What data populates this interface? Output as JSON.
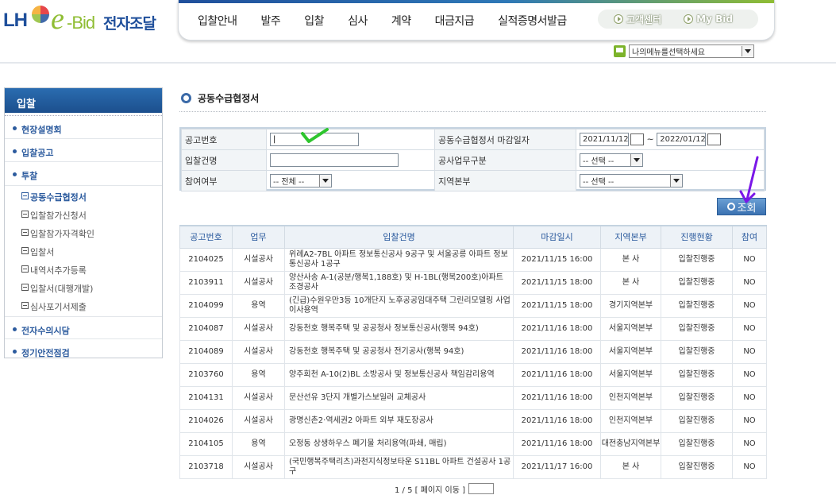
{
  "logo": {
    "lh": "LH",
    "e": "e",
    "bid": "-Bid",
    "kor": "전자조달"
  },
  "gnb": {
    "menu": [
      "입찰안내",
      "발주",
      "입찰",
      "심사",
      "계약",
      "대금지급",
      "실적증명서발급"
    ],
    "quick": [
      "고객센터",
      "My Bid"
    ]
  },
  "menu_select": {
    "value": "나의메뉴를선택하세요"
  },
  "lnb": {
    "title": "입찰",
    "main_items": [
      "현장설명회",
      "입찰공고",
      "투찰"
    ],
    "sub_items": [
      "공동수급협정서",
      "입찰참가신청서",
      "입찰참가자격확인",
      "입찰서",
      "내역서추가등록",
      "입찰서(대행개발)",
      "심사포기서제출"
    ],
    "active_sub": "공동수급협정서",
    "bottom_items": [
      "전자수의시담",
      "정기안전점검"
    ]
  },
  "page_title": "공동수급협정서",
  "search": {
    "notice_no_label": "공고번호",
    "notice_no_value": "|",
    "deadline_label": "공동수급협정서 마감일자",
    "date_from": "2021/11/12",
    "date_sep": "~",
    "date_to": "2022/01/12",
    "bid_name_label": "입찰건명",
    "bid_name_value": "",
    "biz_type_label": "공사업무구분",
    "biz_type_value": "-- 선택 --",
    "participation_label": "참여여부",
    "participation_value": "-- 전체 --",
    "region_label": "지역본부",
    "region_value": "-- 선택 --",
    "button_label": "조회"
  },
  "table": {
    "columns": [
      "공고번호",
      "업무",
      "입찰건명",
      "마감일시",
      "지역본부",
      "진행현황",
      "참여"
    ],
    "rows": [
      [
        "2104025",
        "시설공사",
        "위례A2-7BL 아파트 정보통신공사 9공구 및 서울공릉 아파트 정보통신공사 1공구",
        "2021/11/15 16:00",
        "본 사",
        "입찰진행중",
        "NO"
      ],
      [
        "2103911",
        "시설공사",
        "양산사송 A-1(공분/행복1,188호) 및 H-1BL(행복200호)아파트 조경공사",
        "2021/11/15 18:00",
        "본 사",
        "입찰진행중",
        "NO"
      ],
      [
        "2104099",
        "용역",
        "(긴급)수원우만3등 10개단지 노후공공임대주택 그린리모델링 사업 이사용역",
        "2021/11/15 18:00",
        "경기지역본부",
        "입찰진행중",
        "NO"
      ],
      [
        "2104087",
        "시설공사",
        "강동천호 행복주택 및 공공청사 정보통신공사(행복 94호)",
        "2021/11/16 18:00",
        "서울지역본부",
        "입찰진행중",
        "NO"
      ],
      [
        "2104089",
        "시설공사",
        "강동천호 행복주택 및 공공청사 전기공사(행복 94호)",
        "2021/11/16 18:00",
        "서울지역본부",
        "입찰진행중",
        "NO"
      ],
      [
        "2103760",
        "용역",
        "양주회천 A-10(2)BL 소방공사 및 정보통신공사 책임감리용역",
        "2021/11/16 18:00",
        "서울지역본부",
        "입찰진행중",
        "NO"
      ],
      [
        "2104131",
        "시설공사",
        "문산선유 3단지 개별가스보일러 교체공사",
        "2021/11/16 18:00",
        "인천지역본부",
        "입찰진행중",
        "NO"
      ],
      [
        "2104026",
        "시설공사",
        "광명신촌2·역세권2 아파트 외부 재도장공사",
        "2021/11/16 18:00",
        "인천지역본부",
        "입찰진행중",
        "NO"
      ],
      [
        "2104105",
        "용역",
        "오정동 상생하우스 폐기물 처리용역(파쇄, 매립)",
        "2021/11/16 18:00",
        "대전충남지역본부",
        "입찰진행중",
        "NO"
      ],
      [
        "2103718",
        "시설공사",
        "(국민행복주택리츠)과천지식정보타운 S11BL 아파트 건설공사 1공구",
        "2021/11/17 16:00",
        "본 사",
        "입찰진행중",
        "NO"
      ]
    ]
  },
  "paging": {
    "text": "1 / 5 [ 페이지 이동 ]"
  }
}
